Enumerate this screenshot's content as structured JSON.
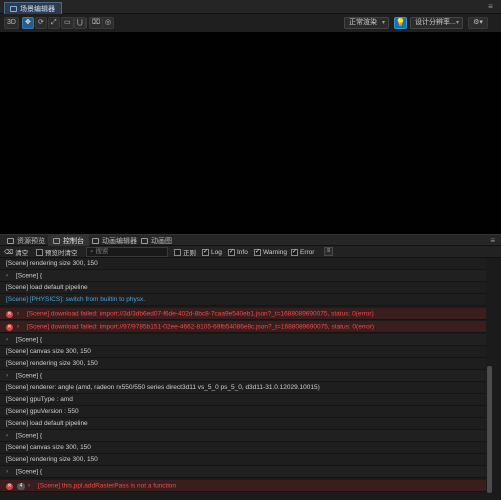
{
  "scene_panel": {
    "tab_label": "场景编辑器",
    "menu_glyph": "≡"
  },
  "toolbar": {
    "btn_3d": "3D",
    "btn_move": "✥",
    "btn_rotate": "⟳",
    "btn_scale": "⤢",
    "btn_rect": "▭",
    "btn_anchor": "⋃",
    "btn_snap": "⌧",
    "btn_world": "◎",
    "render_mode": "正常渲染",
    "light_glyph": "💡",
    "resolution": "设计分辨率...",
    "settings_glyph": "⚙"
  },
  "bottom_tabs": [
    {
      "label": "资源预览"
    },
    {
      "label": "控制台"
    },
    {
      "label": "动画编辑器"
    },
    {
      "label": "动画图"
    }
  ],
  "bottom_menu_glyph": "≡",
  "console_toolbar": {
    "clear": "清空",
    "preview_clear": "预览时清空",
    "search_placeholder": "搜索",
    "regex": "正则",
    "log": "Log",
    "info": "Info",
    "warning": "Warning",
    "error": "Error"
  },
  "log_rows": [
    {
      "type": "info",
      "text": "[Scene] rendering size 300, 150"
    },
    {
      "type": "info",
      "expand": true,
      "text": "[Scene] {"
    },
    {
      "type": "info",
      "text": "[Scene] load default pipeline"
    },
    {
      "type": "physics",
      "text": "[Scene] [PHYSICS]: switch from builtin to physx."
    },
    {
      "type": "err",
      "text": "[Scene] download failed: import://3d/3db6ed07-f6de-402d-8bc8-7caa9e540eb1.json?_t=1688089690075, status: 0(error)"
    },
    {
      "type": "err",
      "text": "[Scene] download failed: import://97/9785b151-02ee-4662-8105-69fb54086e8c.json?_t=1688089690075, status: 0(error)"
    },
    {
      "type": "info",
      "expand": true,
      "text": "[Scene] {"
    },
    {
      "type": "info",
      "text": "[Scene] canvas size 300, 150"
    },
    {
      "type": "info",
      "text": "[Scene] rendering size 300, 150"
    },
    {
      "type": "info",
      "expand": true,
      "text": "[Scene] {"
    },
    {
      "type": "info",
      "text": "[Scene] renderer: angle (amd, radeon rx550/550 series direct3d11 vs_5_0 ps_5_0, d3d11-31.0.12029.10015)"
    },
    {
      "type": "info",
      "text": "[Scene] gpuType : amd"
    },
    {
      "type": "info",
      "text": "[Scene] gpuVersion : 550"
    },
    {
      "type": "info",
      "text": "[Scene] load default pipeline"
    },
    {
      "type": "info",
      "expand": true,
      "text": "[Scene] {"
    },
    {
      "type": "info",
      "text": "[Scene] canvas size 300, 150"
    },
    {
      "type": "info",
      "text": "[Scene] rendering size 300, 150"
    },
    {
      "type": "info",
      "expand": true,
      "text": "[Scene] {"
    },
    {
      "type": "err",
      "count": "4",
      "text": "[Scene] this.ppl.addRasterPass is not a function"
    }
  ]
}
